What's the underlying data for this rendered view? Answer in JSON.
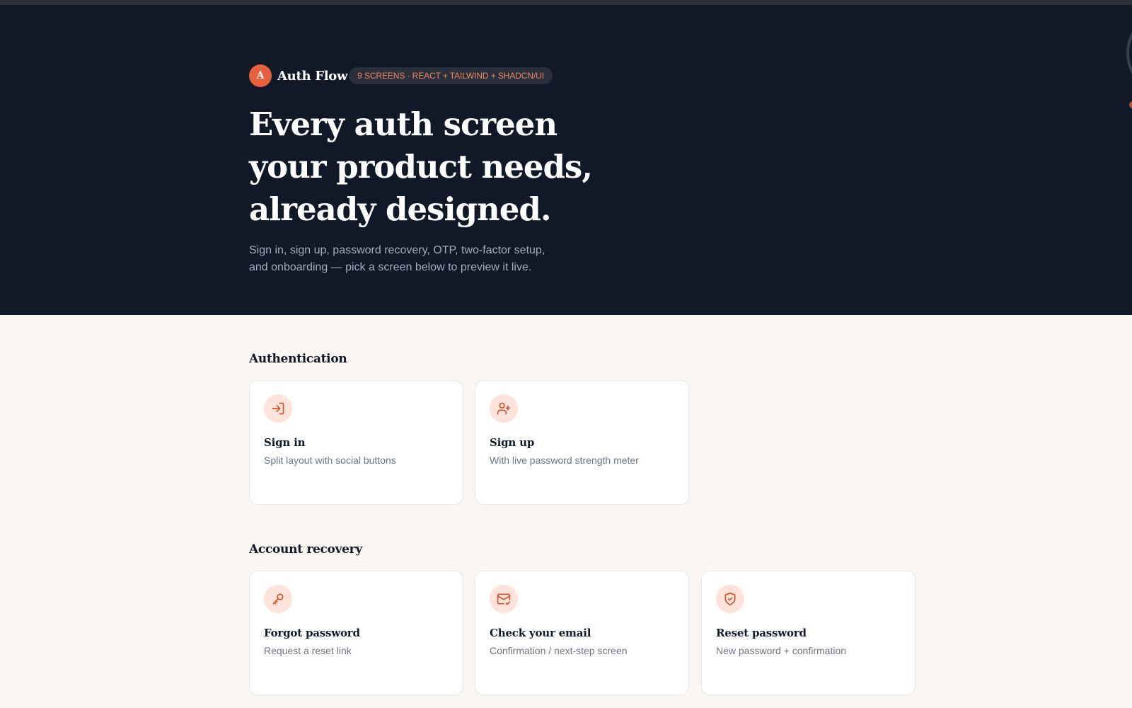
{
  "brand": {
    "logo_letter": "A",
    "name": "Auth Flow",
    "badge": "9 SCREENS · REACT + TAILWIND + SHADCN/UI"
  },
  "hero": {
    "title_line1": "Every auth screen",
    "title_line2": "your product needs,",
    "title_line3": "already designed.",
    "subtitle_line1": "Sign in, sign up, password recovery, OTP, two-factor setup,",
    "subtitle_line2": "and onboarding — pick a screen below to preview it live."
  },
  "sections": [
    {
      "title": "Authentication",
      "cards": [
        {
          "icon": "sign-in-icon",
          "title": "Sign in",
          "description": "Split layout with social buttons"
        },
        {
          "icon": "user-plus-icon",
          "title": "Sign up",
          "description": "With live password strength meter"
        }
      ]
    },
    {
      "title": "Account recovery",
      "cards": [
        {
          "icon": "key-icon",
          "title": "Forgot password",
          "description": "Request a reset link"
        },
        {
          "icon": "mail-check-icon",
          "title": "Check your email",
          "description": "Confirmation / next-step screen"
        },
        {
          "icon": "shield-check-icon",
          "title": "Reset password",
          "description": "New password + confirmation"
        }
      ]
    }
  ],
  "colors": {
    "accent": "#e8613c",
    "hero_background": "#111827",
    "page_background": "#faf7f3",
    "icon_background": "#fde3d9"
  }
}
